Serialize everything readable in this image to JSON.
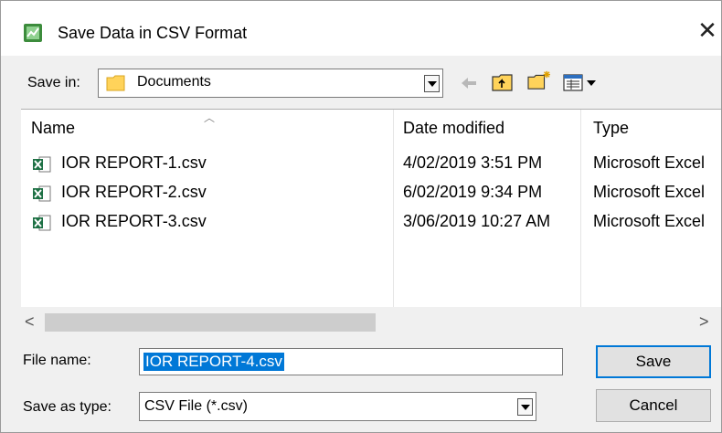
{
  "window": {
    "title": "Save Data in CSV Format",
    "close_glyph": "✕"
  },
  "save_in": {
    "label": "Save in:",
    "value": "Documents"
  },
  "toolbar": {
    "icons": [
      "back-arrow-icon",
      "up-folder-icon",
      "new-folder-icon",
      "view-menu-icon"
    ]
  },
  "columns": {
    "name": "Name",
    "date_modified": "Date modified",
    "type": "Type"
  },
  "files": [
    {
      "name": "IOR REPORT-1.csv",
      "date": "4/02/2019 3:51 PM",
      "type": "Microsoft Excel"
    },
    {
      "name": "IOR REPORT-2.csv",
      "date": "6/02/2019 9:34 PM",
      "type": "Microsoft Excel"
    },
    {
      "name": "IOR REPORT-3.csv",
      "date": "3/06/2019 10:27 AM",
      "type": "Microsoft Excel"
    }
  ],
  "scrollbar": {
    "left_glyph": "<",
    "right_glyph": ">"
  },
  "file_name": {
    "label": "File name:",
    "value": "IOR REPORT-4.csv"
  },
  "save_as_type": {
    "label": "Save as type:",
    "value": "CSV File (*.csv)"
  },
  "buttons": {
    "save": "Save",
    "cancel": "Cancel"
  },
  "colors": {
    "selection": "#0078d7",
    "folder": "#ffd35a",
    "excel": "#1e7145"
  }
}
